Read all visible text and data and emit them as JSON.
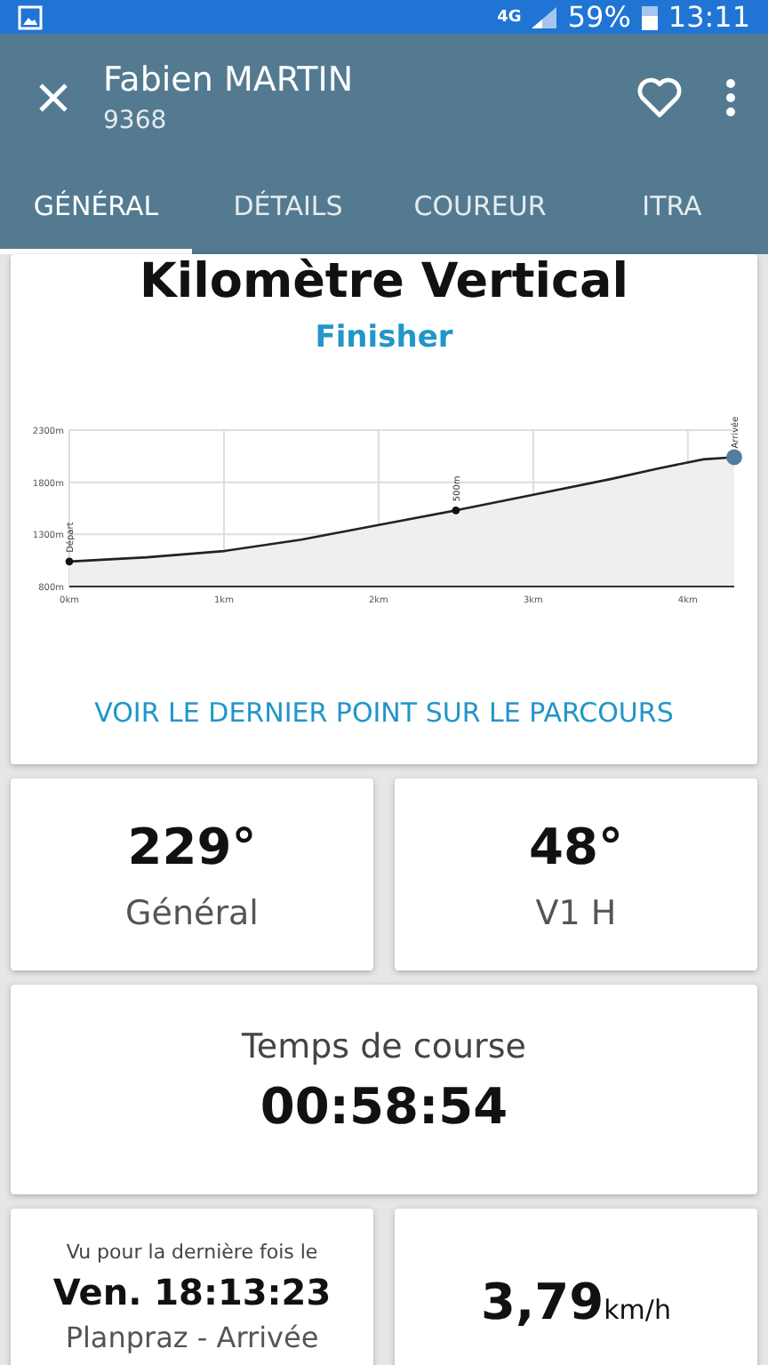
{
  "status_bar": {
    "network": "4G",
    "battery": "59%",
    "time": "13:11"
  },
  "header": {
    "name": "Fabien MARTIN",
    "bib": "9368",
    "favorite": false
  },
  "tabs": [
    {
      "label": "GÉNÉRAL",
      "selected": true
    },
    {
      "label": "DÉTAILS",
      "selected": false
    },
    {
      "label": "COUREUR",
      "selected": false
    },
    {
      "label": "ITRA",
      "selected": false
    }
  ],
  "race": {
    "title": "Kilomètre Vertical",
    "status": "Finisher",
    "chart_data": {
      "type": "area",
      "grid": true,
      "x": [
        0,
        0.5,
        1,
        1.5,
        2,
        2.5,
        3,
        3.5,
        3.8,
        4.1,
        4.3
      ],
      "series": [
        {
          "color": "#222222",
          "values": [
            1040,
            1080,
            1140,
            1250,
            1390,
            1530,
            1680,
            1830,
            1930,
            2020,
            2040
          ]
        }
      ],
      "xlim": [
        0,
        4.3
      ],
      "ylim": [
        800,
        2300
      ],
      "xticks": [
        {
          "value": 0,
          "label": "0km"
        },
        {
          "value": 1,
          "label": "1km"
        },
        {
          "value": 2,
          "label": "2km"
        },
        {
          "value": 3,
          "label": "3km"
        },
        {
          "value": 4,
          "label": "4km"
        }
      ],
      "yticks": [
        {
          "value": 800,
          "label": "800m"
        },
        {
          "value": 1300,
          "label": "1300m"
        },
        {
          "value": 1800,
          "label": "1800m"
        },
        {
          "value": 2300,
          "label": "2300m"
        }
      ]
    },
    "checkpoints": [
      {
        "label": "Départ"
      },
      {
        "label": "500m"
      },
      {
        "label": "Arrivée"
      }
    ],
    "link": "VOIR LE DERNIER POINT SUR LE PARCOURS"
  },
  "ranks": [
    {
      "value": "229°",
      "label": "Général"
    },
    {
      "value": "48°",
      "label": "V1 H"
    }
  ],
  "time": {
    "label": "Temps de course",
    "value": "00:58:54"
  },
  "last_seen": {
    "label": "Vu pour la dernière fois le",
    "value": "Ven. 18:13:23",
    "place": "Planpraz - Arrivée"
  },
  "speed": {
    "value": "3,79",
    "unit": "km/h"
  }
}
